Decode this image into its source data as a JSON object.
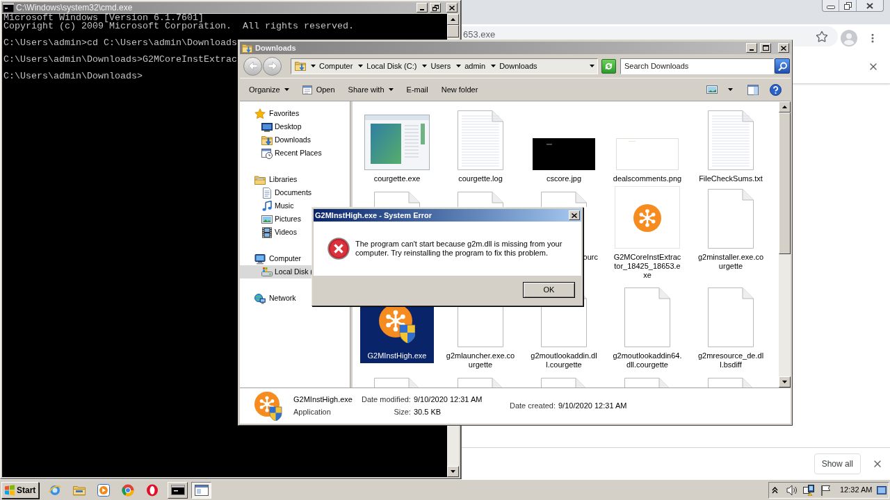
{
  "browser": {
    "address_text": "653.exe",
    "shelf_button": "Show all"
  },
  "cmd_window": {
    "title": "C:\\Windows\\system32\\cmd.exe",
    "lines": [
      "Microsoft Windows [Version 6.1.7601]",
      "Copyright (c) 2009 Microsoft Corporation.  All rights reserved.",
      "C:\\Users\\admin>cd C:\\Users\\admin\\Downloads",
      "C:\\Users\\admin\\Downloads>G2MCoreInstExtrac",
      "C:\\Users\\admin\\Downloads>"
    ]
  },
  "explorer": {
    "title": "Downloads",
    "breadcrumb": [
      "Computer",
      "Local Disk (C:)",
      "Users",
      "admin",
      "Downloads"
    ],
    "search": {
      "placeholder": "Search Downloads"
    },
    "toolbar": [
      {
        "label": "Organize",
        "kind": "menu"
      },
      {
        "label": "Open",
        "kind": "icon"
      },
      {
        "label": "Share with",
        "kind": "menu"
      },
      {
        "label": "E-mail",
        "kind": "plain"
      },
      {
        "label": "New folder",
        "kind": "plain"
      }
    ],
    "sidebar": [
      {
        "label": "Favorites",
        "selected": false,
        "children": [
          {
            "label": "Desktop",
            "selected": false
          },
          {
            "label": "Downloads",
            "selected": false
          },
          {
            "label": "Recent Places",
            "selected": false
          }
        ]
      },
      {
        "label": "Libraries",
        "selected": false,
        "children": [
          {
            "label": "Documents",
            "selected": false
          },
          {
            "label": "Music",
            "selected": false
          },
          {
            "label": "Pictures",
            "selected": false
          },
          {
            "label": "Videos",
            "selected": false
          }
        ]
      },
      {
        "label": "Computer",
        "selected": false,
        "children": [
          {
            "label": "Local Disk (",
            "selected": true
          }
        ]
      },
      {
        "label": "Network",
        "selected": false
      }
    ],
    "files": [
      {
        "name": "courgette.exe",
        "kind": "window-thumbnail",
        "selected": false
      },
      {
        "name": "courgette.log",
        "kind": "text-file",
        "selected": false
      },
      {
        "name": "cscore.jpg",
        "kind": "dark-thumbnail",
        "selected": false
      },
      {
        "name": "dealscomments.png",
        "kind": "light-thumbnail",
        "selected": false
      },
      {
        "name": "FileCheckSums.txt",
        "kind": "text-file",
        "selected": false
      },
      {
        "kind": "file-top",
        "selected": false
      },
      {
        "kind": "file-top",
        "selected": false
      },
      {
        "name": "ourc",
        "kind": "file-top",
        "selected": false
      },
      {
        "name": "G2MCoreInstExtractor_18425_18653.exe",
        "kind": "app-tile",
        "selected": false
      },
      {
        "name": "g2minstaller.exe.courgette",
        "kind": "blank-file",
        "selected": false
      },
      {
        "name": "G2MInstHigh.exe",
        "kind": "app-shield",
        "selected": true
      },
      {
        "name": "g2mlauncher.exe.courgette",
        "kind": "blank-file",
        "selected": false
      },
      {
        "name": "g2moutlookaddin.dll.courgette",
        "kind": "blank-file",
        "selected": false
      },
      {
        "name": "g2moutlookaddin64.dll.courgette",
        "kind": "blank-file",
        "selected": false
      },
      {
        "name": "g2mresource_de.dll.bsdiff",
        "kind": "blank-file",
        "selected": false
      },
      {
        "kind": "file-top",
        "selected": false
      },
      {
        "kind": "file-top",
        "selected": false
      },
      {
        "kind": "file-top",
        "selected": false
      },
      {
        "kind": "file-top",
        "selected": false
      },
      {
        "kind": "file-top",
        "selected": false
      }
    ],
    "details": {
      "name": "G2MInstHigh.exe",
      "type": "Application",
      "columns": [
        [
          {
            "label": "Date modified:",
            "value": "9/10/2020 12:31 AM"
          },
          {
            "label": "Size:",
            "value": "30.5 KB"
          }
        ],
        [
          {
            "label": "Date created:",
            "value": "9/10/2020 12:31 AM"
          }
        ]
      ]
    }
  },
  "dialog": {
    "title": "G2MInstHigh.exe - System Error",
    "message": "The program can't start because g2m.dll is missing from your computer. Try reinstalling the program to fix this problem.",
    "button": "OK"
  },
  "taskbar": {
    "start": "Start",
    "tasks": [
      {
        "selected": false
      },
      {
        "selected": true
      }
    ],
    "clock": "12:32 AM"
  }
}
